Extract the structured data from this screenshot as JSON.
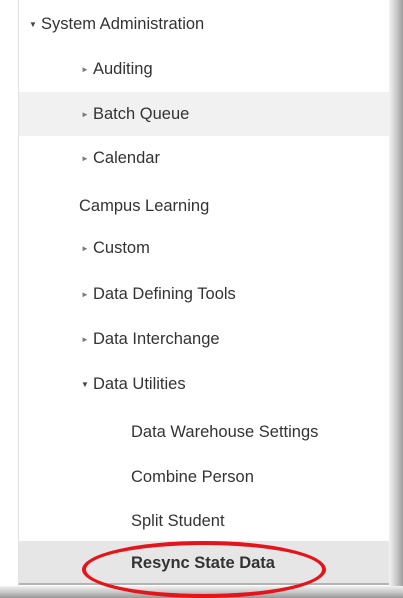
{
  "tree": {
    "items": [
      {
        "label": "System Administration",
        "expander": "▼"
      },
      {
        "label": "Auditing",
        "expander": "►"
      },
      {
        "label": "Batch Queue",
        "expander": "►"
      },
      {
        "label": "Calendar",
        "expander": "►"
      },
      {
        "label": "Campus Learning"
      },
      {
        "label": "Custom",
        "expander": "►"
      },
      {
        "label": "Data Defining Tools",
        "expander": "►"
      },
      {
        "label": "Data Interchange",
        "expander": "►"
      },
      {
        "label": "Data Utilities",
        "expander": "▼"
      },
      {
        "label": "Data Warehouse Settings"
      },
      {
        "label": "Combine Person"
      },
      {
        "label": "Split Student"
      },
      {
        "label": "Resync State Data"
      }
    ]
  },
  "annotation": {
    "color": "#e5141b"
  }
}
